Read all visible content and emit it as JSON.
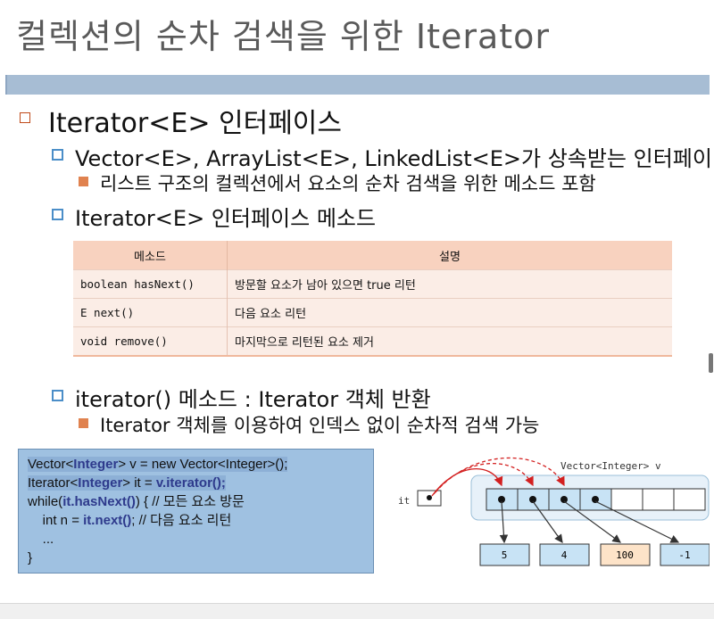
{
  "title": "컬렉션의 순차 검색을 위한 Iterator",
  "bullets": {
    "b1": "Iterator<E> 인터페이스",
    "b2a": "Vector<E>, ArrayList<E>, LinkedList<E>가 상속받는 인터페이",
    "b3a": "리스트 구조의 컬렉션에서 요소의 순차 검색을 위한 메소드 포함",
    "b2b": "Iterator<E> 인터페이스 메소드",
    "b2c": "iterator() 메소드 : Iterator 객체 반환",
    "b3b": "Iterator 객체를 이용하여 인덱스 없이 순차적 검색 가능"
  },
  "table": {
    "headers": [
      "메소드",
      "설명"
    ],
    "rows": [
      {
        "method": "boolean hasNext()",
        "desc": "방문할 요소가 남아 있으면 true 리턴"
      },
      {
        "method": "E next()",
        "desc": "다음 요소 리턴"
      },
      {
        "method": "void remove()",
        "desc": "마지막으로 리턴된 요소 제거"
      }
    ]
  },
  "code": {
    "l1a": "Vector<",
    "l1b": "Integer",
    "l1c": "> v = new Vector<Integer>();",
    "l2a": "Iterator<",
    "l2b": "Integer",
    "l2c": "> it = ",
    "l2d": "v.iterator();",
    "l3a": "while(",
    "l3b": "it.hasNext()",
    "l3c": ") { // 모든 요소 방문",
    "l4a": "    int n = ",
    "l4b": "it.next()",
    "l4c": "; // 다음 요소 리턴",
    "l5": "    ...",
    "l6": "}"
  },
  "diagram": {
    "it_label": "it",
    "vector_label": "Vector<Integer> v",
    "values": [
      "5",
      "4",
      "100",
      "-1"
    ]
  }
}
